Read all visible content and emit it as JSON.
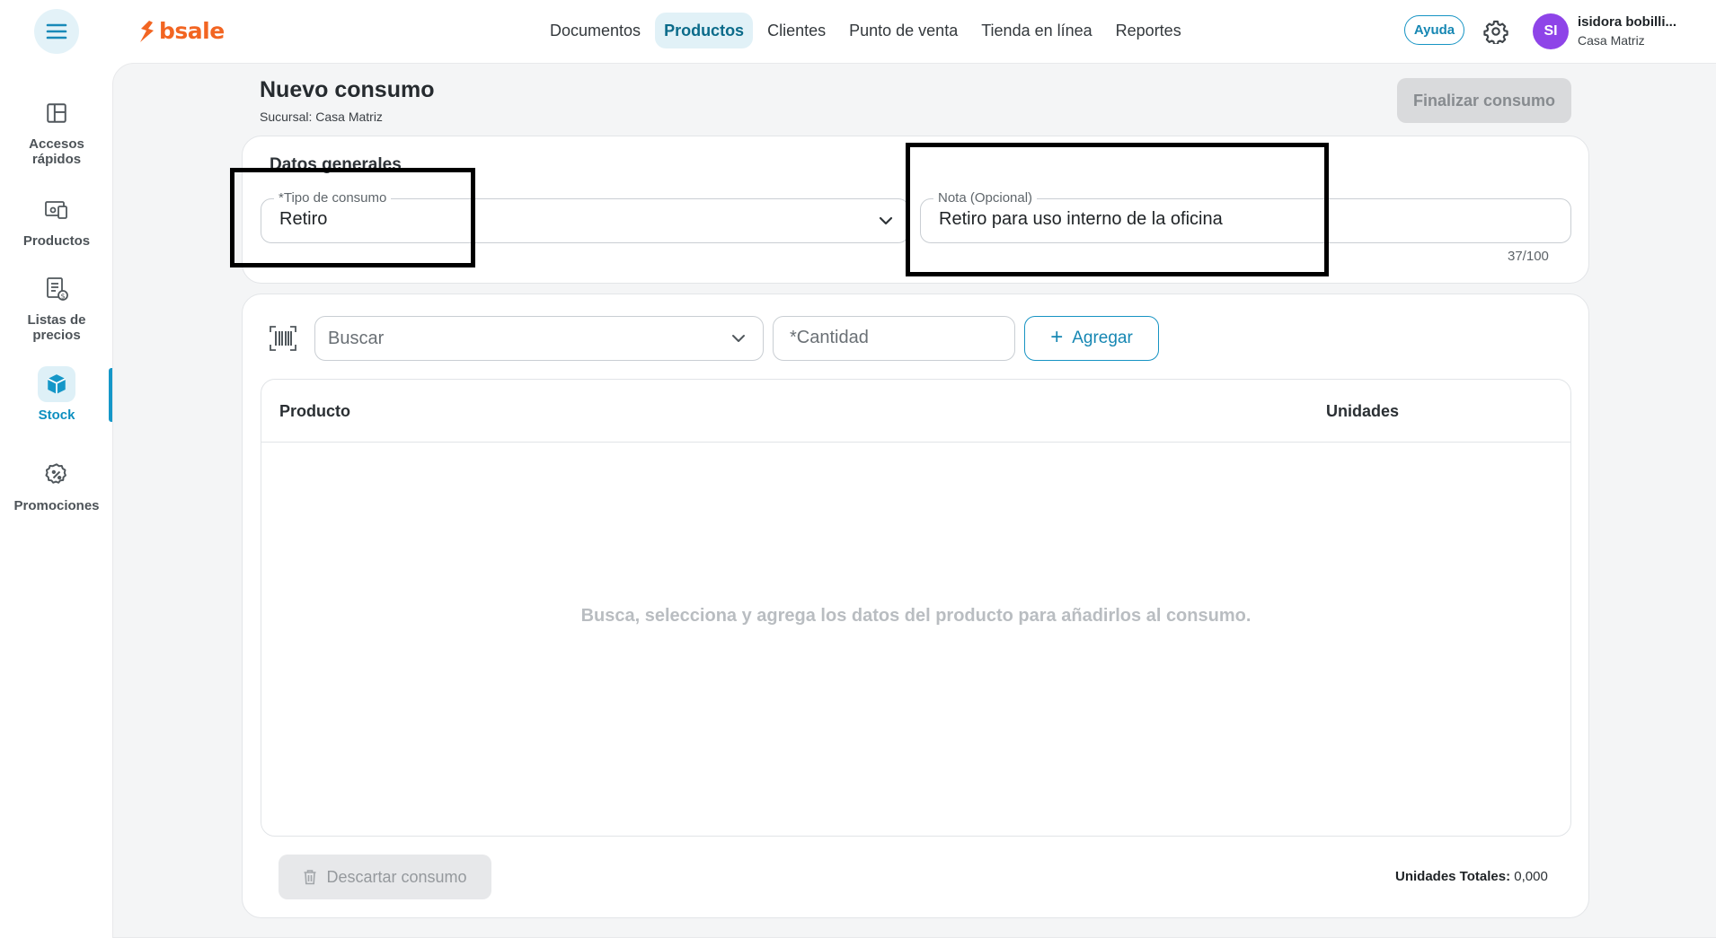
{
  "app": {
    "brand": "bsale",
    "brand_color": "#f26522",
    "accent_color": "#1597c8"
  },
  "topnav": {
    "items": [
      {
        "label": "Documentos",
        "active": false
      },
      {
        "label": "Productos",
        "active": true
      },
      {
        "label": "Clientes",
        "active": false
      },
      {
        "label": "Punto de venta",
        "active": false
      },
      {
        "label": "Tienda en línea",
        "active": false
      },
      {
        "label": "Reportes",
        "active": false
      }
    ],
    "help_label": "Ayuda",
    "settings_icon": "gear-icon",
    "menu_icon": "hamburger-menu-icon"
  },
  "user": {
    "initials": "SI",
    "name": "isidora bobilli...",
    "branch": "Casa Matriz",
    "avatar_color": "#8e44e8"
  },
  "sidebar": {
    "items": [
      {
        "label": "Accesos rápidos",
        "icon": "layout-grid-icon",
        "active": false
      },
      {
        "label": "Productos",
        "icon": "devices-icon",
        "active": false
      },
      {
        "label": "Listas de precios",
        "icon": "price-list-icon",
        "active": false
      },
      {
        "label": "Stock",
        "icon": "box-icon",
        "active": true
      },
      {
        "label": "Promociones",
        "icon": "discount-badge-icon",
        "active": false
      }
    ]
  },
  "page": {
    "title": "Nuevo consumo",
    "subtitle": "Sucursal: Casa Matriz",
    "finish_label": "Finalizar consumo"
  },
  "general": {
    "section_title": "Datos generales",
    "tipo_label": "*Tipo de consumo",
    "tipo_value": "Retiro",
    "nota_label": "Nota (Opcional)",
    "nota_value": "Retiro para uso interno de la oficina",
    "nota_count": "37/100"
  },
  "products": {
    "search_placeholder": "Buscar",
    "quantity_placeholder": "*Cantidad",
    "add_label": "Agregar",
    "columns": [
      "Producto",
      "Unidades"
    ],
    "rows": [],
    "empty_message": "Busca, selecciona y agrega los datos del producto para añadirlos al consumo.",
    "discard_label": "Descartar consumo",
    "totals_label": "Unidades Totales:",
    "totals_value": "0,000"
  }
}
